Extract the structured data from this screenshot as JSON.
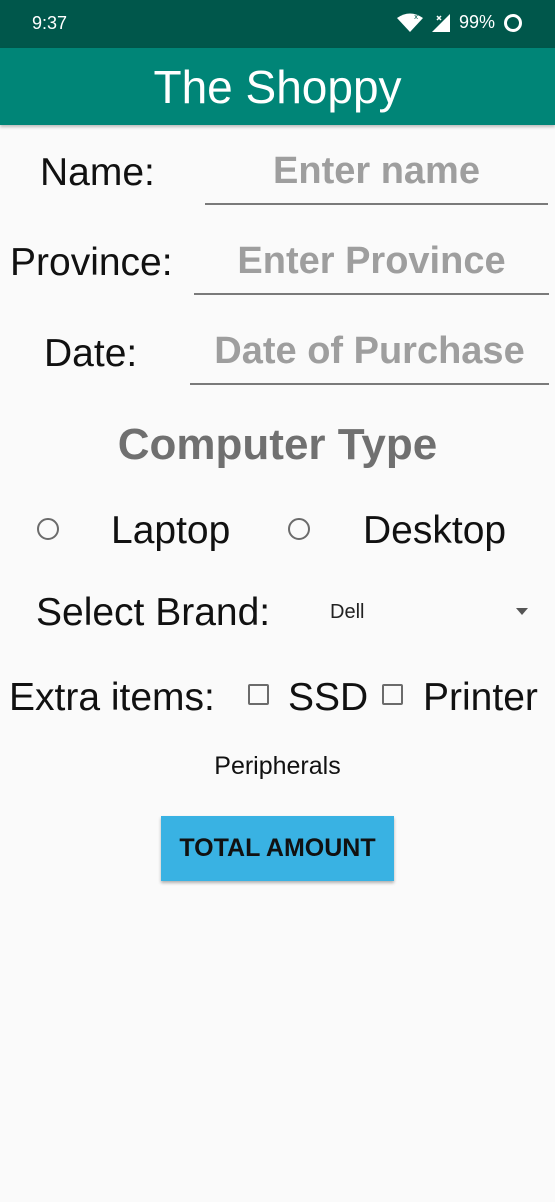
{
  "status_bar": {
    "time": "9:37",
    "battery": "99%"
  },
  "app_bar": {
    "title": "The Shoppy"
  },
  "form": {
    "name_label": "Name:",
    "name_placeholder": "Enter name",
    "province_label": "Province:",
    "province_placeholder": "Enter Province",
    "date_label": "Date:",
    "date_placeholder": "Date of Purchase",
    "computer_type_title": "Computer Type",
    "radio_laptop": "Laptop",
    "radio_desktop": "Desktop",
    "brand_label": "Select Brand:",
    "brand_selected": "Dell",
    "extra_label": "Extra items:",
    "check_ssd": "SSD",
    "check_printer": "Printer",
    "peripherals_label": "Peripherals",
    "total_button": "TOTAL AMOUNT"
  },
  "colors": {
    "status_bar": "#00574b",
    "app_bar": "#008577",
    "button": "#39b2e3"
  }
}
